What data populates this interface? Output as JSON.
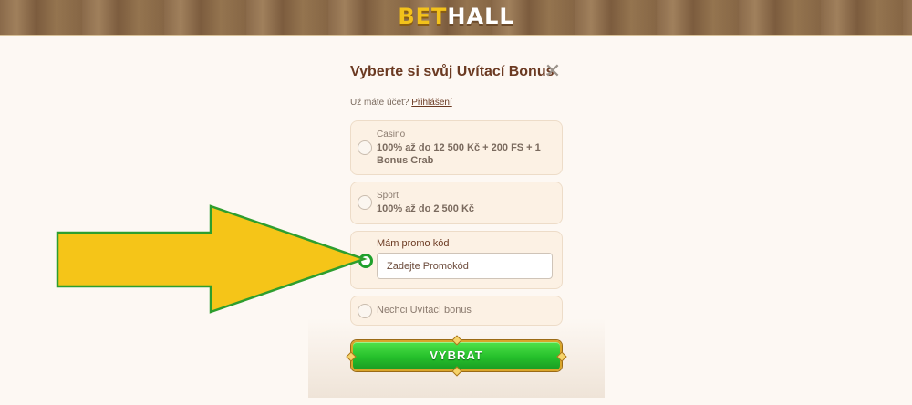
{
  "header": {
    "logo_part1": "BET",
    "logo_part2": "HALL"
  },
  "modal": {
    "title": "Vyberte si svůj Uvítací Bonus",
    "login_prompt": "Už máte účet?",
    "login_link": "Přihlášení",
    "options": [
      {
        "category": "Casino",
        "description": "100% až do 12 500 Kč + 200 FS + 1 Bonus Crab",
        "selected": false
      },
      {
        "category": "Sport",
        "description": "100% až do 2 500 Kč",
        "selected": false
      },
      {
        "label": "Mám promo kód",
        "placeholder": "Zadejte Promokód",
        "selected": true
      },
      {
        "label": "Nechci Uvítací bonus",
        "selected": false
      }
    ],
    "submit_label": "VYBRAT"
  },
  "annotation": {
    "arrow_color": "#f5c518",
    "arrow_outline": "#2e9e2e"
  }
}
